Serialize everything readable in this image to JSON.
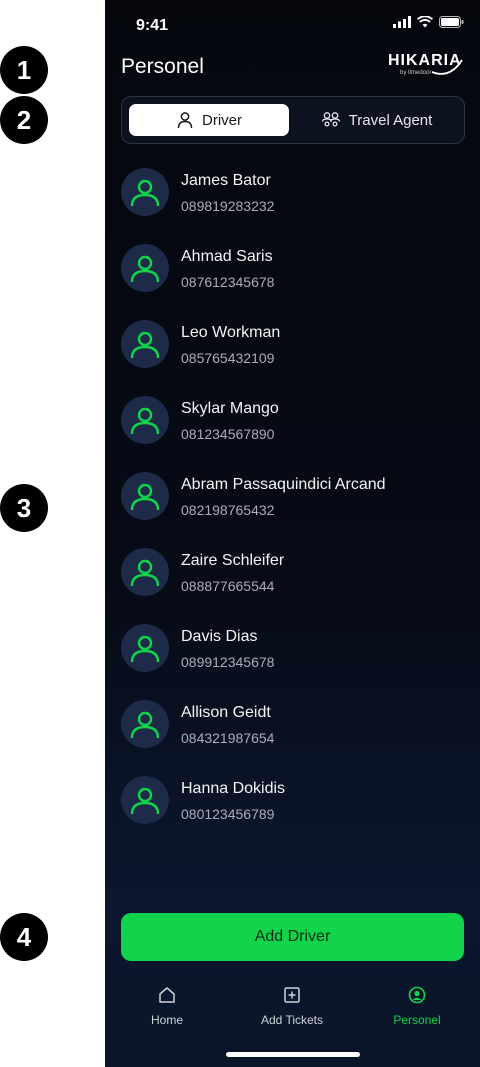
{
  "callouts": [
    "1",
    "2",
    "3",
    "4"
  ],
  "status_bar": {
    "time": "9:41"
  },
  "header": {
    "title": "Personel",
    "logo_text": "HIKARIA",
    "logo_subtitle": "by timedoor"
  },
  "segmented_control": {
    "driver_label": "Driver",
    "travel_agent_label": "Travel Agent",
    "selected": "Driver"
  },
  "drivers": [
    {
      "name": "James Bator",
      "phone": "089819283232"
    },
    {
      "name": "Ahmad Saris",
      "phone": "087612345678"
    },
    {
      "name": "Leo Workman",
      "phone": "085765432109"
    },
    {
      "name": "Skylar Mango",
      "phone": "081234567890"
    },
    {
      "name": "Abram Passaquindici Arcand",
      "phone": "082198765432"
    },
    {
      "name": "Zaire Schleifer",
      "phone": "088877665544"
    },
    {
      "name": "Davis Dias",
      "phone": "089912345678"
    },
    {
      "name": "Allison Geidt",
      "phone": "084321987654"
    },
    {
      "name": "Hanna Dokidis",
      "phone": "080123456789"
    }
  ],
  "add_button": {
    "label": "Add Driver"
  },
  "tab_bar": {
    "home": "Home",
    "add_tickets": "Add Tickets",
    "personel": "Personel",
    "active": "Personel"
  },
  "colors": {
    "accent_green": "#12d44a",
    "avatar_bg": "#1d2a48",
    "background_dark": "#05070d"
  },
  "icons": {
    "user": "user-icon",
    "group": "group-icon",
    "home": "home-icon",
    "add_ticket": "add-ticket-icon",
    "personel": "personel-icon"
  }
}
